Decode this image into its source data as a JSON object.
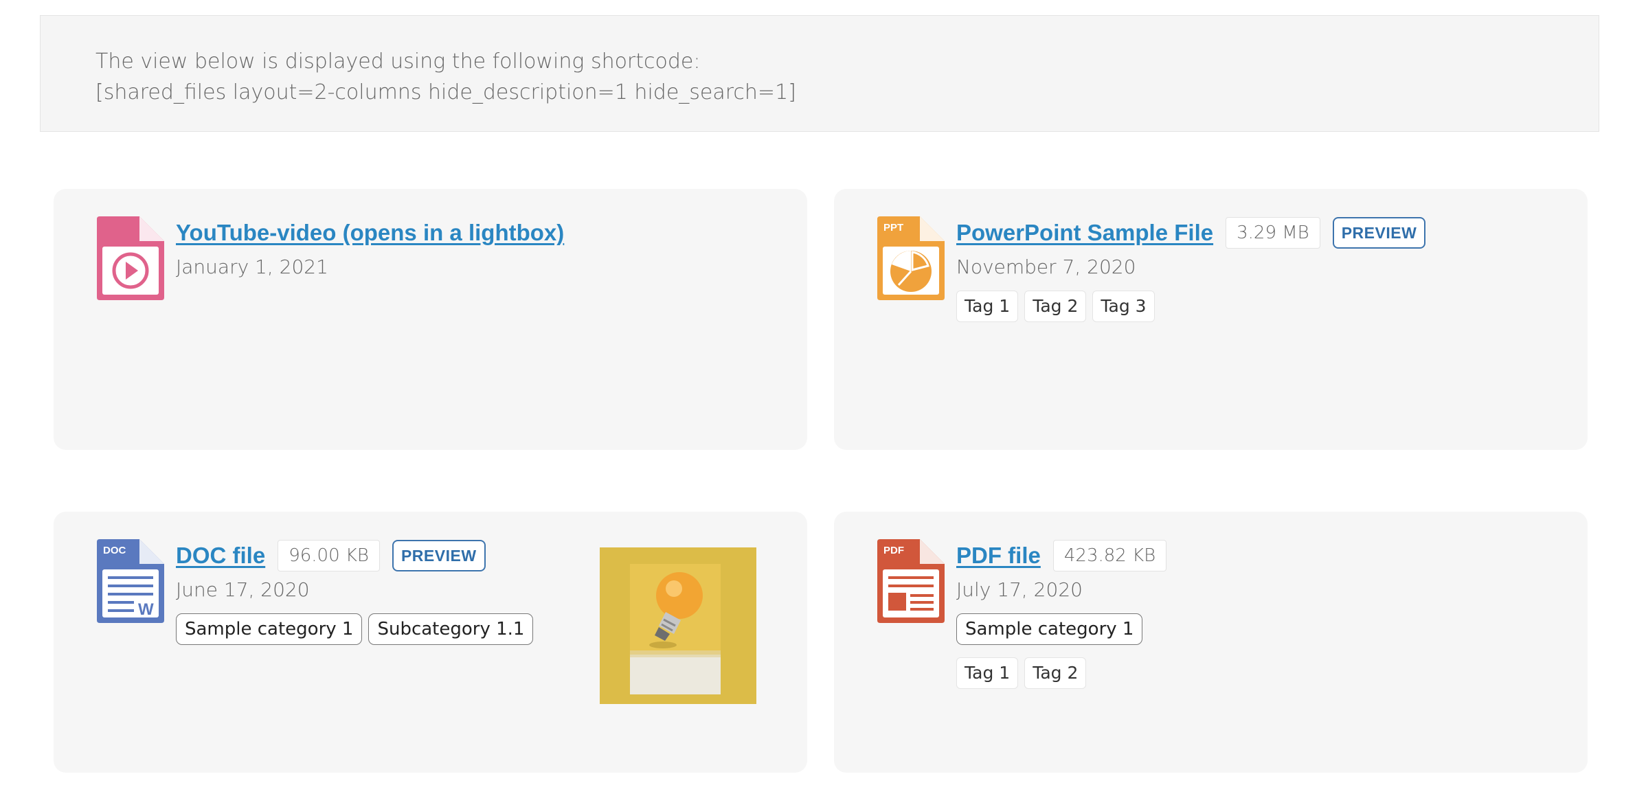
{
  "notice": {
    "line1": "The view below is displayed using the following shortcode:",
    "line2": "[shared_files layout=2-columns hide_description=1 hide_search=1]"
  },
  "files": [
    {
      "title": "YouTube-video (opens in a lightbox)",
      "date": "January 1, 2021",
      "icon": "video-file-icon",
      "icon_color": "#e0628b"
    },
    {
      "title": "PowerPoint Sample File",
      "size": "3.29 MB",
      "preview_label": "PREVIEW",
      "date": "November 7, 2020",
      "tags": [
        "Tag 1",
        "Tag 2",
        "Tag 3"
      ],
      "icon": "ppt-file-icon",
      "icon_label": "PPT",
      "icon_color": "#f0a23c"
    },
    {
      "title": "DOC file",
      "size": "96.00 KB",
      "preview_label": "PREVIEW",
      "date": "June 17, 2020",
      "categories": [
        "Sample category 1",
        "Subcategory 1.1"
      ],
      "icon": "doc-file-icon",
      "icon_label": "DOC",
      "icon_color": "#5a79bf",
      "thumbnail": "lightbulb-thumbnail"
    },
    {
      "title": "PDF file",
      "size": "423.82 KB",
      "date": "July 17, 2020",
      "categories": [
        "Sample category 1"
      ],
      "tags": [
        "Tag 1",
        "Tag 2"
      ],
      "icon": "pdf-file-icon",
      "icon_label": "PDF",
      "icon_color": "#d1573b"
    }
  ]
}
